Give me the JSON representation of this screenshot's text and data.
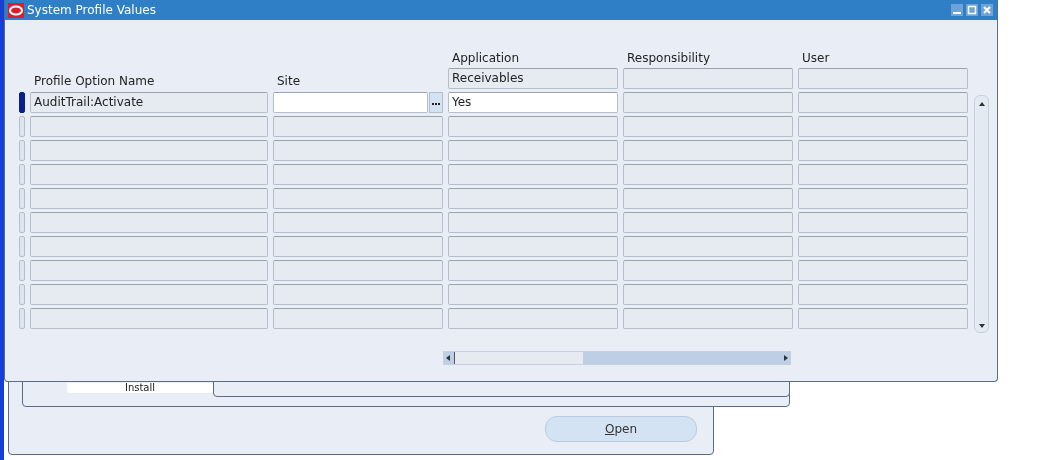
{
  "window": {
    "title": "System Profile Values"
  },
  "columns": [
    {
      "label": "Profile Option Name"
    },
    {
      "label": "Site"
    },
    {
      "label": "Application"
    },
    {
      "label": "Responsibility"
    },
    {
      "label": "User"
    }
  ],
  "application_field": {
    "value": "Receivables"
  },
  "rows": [
    {
      "selected": true,
      "profile_option_name": "AuditTrail:Activate",
      "application": "Yes"
    },
    {
      "selected": false
    },
    {
      "selected": false
    },
    {
      "selected": false
    },
    {
      "selected": false
    },
    {
      "selected": false
    },
    {
      "selected": false
    },
    {
      "selected": false
    },
    {
      "selected": false
    },
    {
      "selected": false
    }
  ],
  "background_window": {
    "tab_label": "Install",
    "button": "Open"
  }
}
